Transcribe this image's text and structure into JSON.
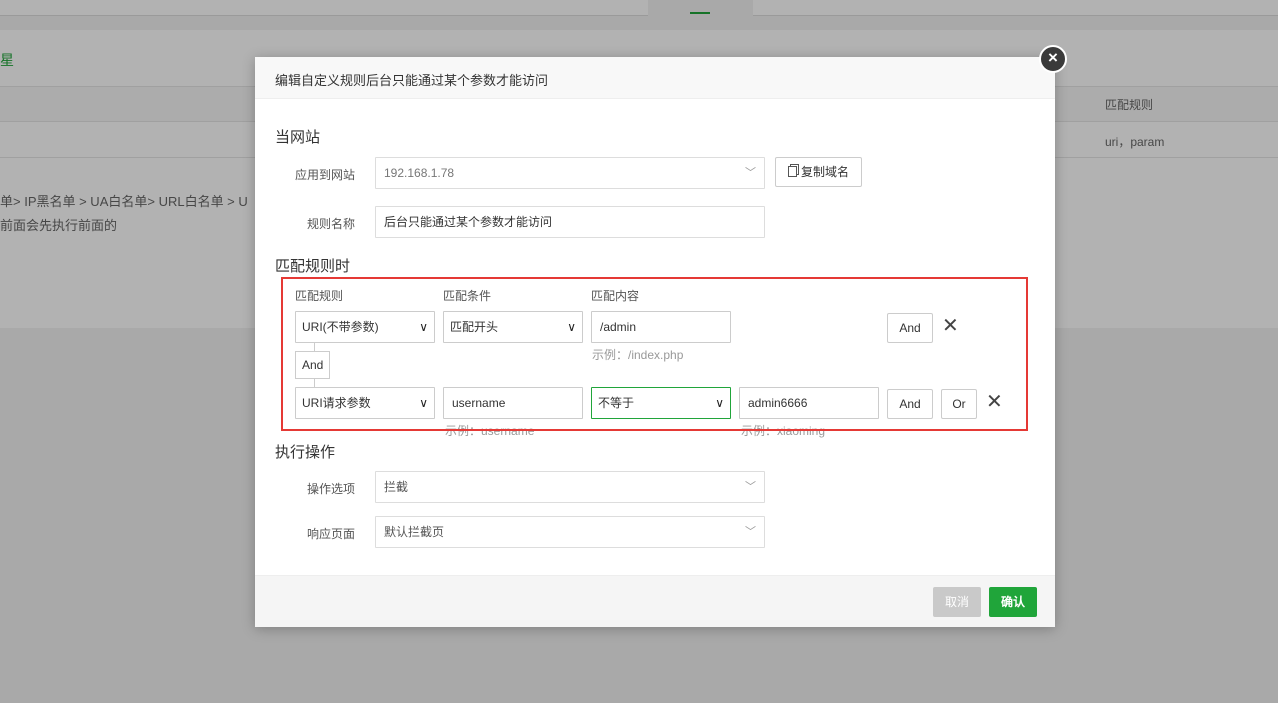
{
  "background": {
    "link_text": "星",
    "col_header": "匹配规则",
    "col_cell": "uri，param",
    "breadcrumb": "单> IP黑名单 > UA白名单> URL白名单 > U",
    "note": "前面会先执行前面的"
  },
  "modal": {
    "title": "编辑自定义规则后台只能通过某个参数才能访问",
    "close_icon": "×",
    "section_site": "当网站",
    "apply_site_label": "应用到网站",
    "apply_site_value": "192.168.1.78",
    "copy_domain_label": "复制域名",
    "rule_name_label": "规则名称",
    "rule_name_value": "后台只能通过某个参数才能访问",
    "section_match": "匹配规则时",
    "match": {
      "col_rule": "匹配规则",
      "col_condition": "匹配条件",
      "col_content": "匹配内容",
      "row1": {
        "rule": "URI(不带参数)",
        "condition": "匹配开头",
        "content": "/admin",
        "hint": "示例：/index.php",
        "and_label": "And"
      },
      "connector": "And",
      "row2": {
        "rule": "URI请求参数",
        "param": "username",
        "param_hint": "示例：username",
        "condition": "不等于",
        "content": "admin6666",
        "content_hint": "示例：xiaoming",
        "and_label": "And",
        "or_label": "Or"
      }
    },
    "section_action": "执行操作",
    "action_label": "操作选项",
    "action_value": "拦截",
    "response_label": "响应页面",
    "response_value": "默认拦截页",
    "cancel_label": "取消",
    "confirm_label": "确认"
  },
  "colors": {
    "accent": "#20a53a",
    "highlight_box": "#e53935"
  }
}
